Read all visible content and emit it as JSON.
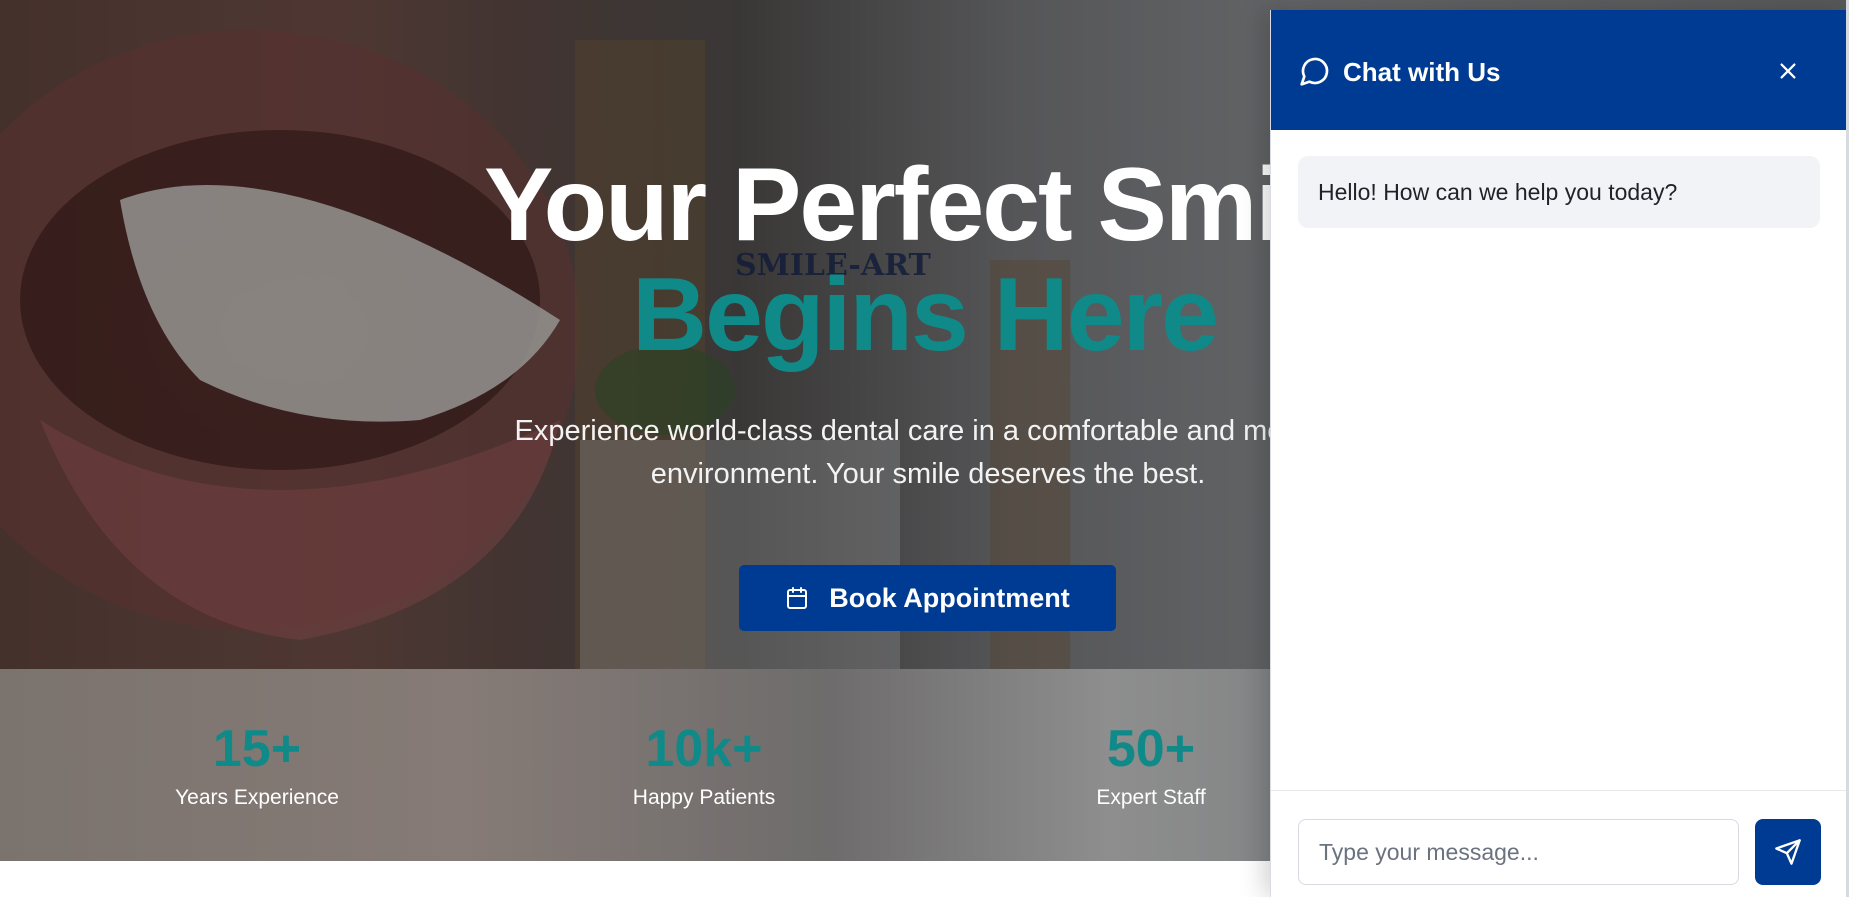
{
  "hero": {
    "title_line1": "Your Perfect Smile",
    "title_line2": "Begins Here",
    "subtitle": "Experience world-class dental care in a comfortable and modern environment. Your smile deserves the best.",
    "book_button_label": "Book Appointment",
    "book_button_icon": "calendar-icon",
    "background_sign_text": "SMILE-ART"
  },
  "stats": [
    {
      "value": "15+",
      "label": "Years Experience"
    },
    {
      "value": "10k+",
      "label": "Happy Patients"
    },
    {
      "value": "50+",
      "label": "Expert Staff"
    }
  ],
  "chat": {
    "title": "Chat with Us",
    "header_icon": "chat-bubble-icon",
    "close_icon": "close-icon",
    "messages": [
      {
        "from": "bot",
        "text": "Hello! How can we help you today?"
      }
    ],
    "input_placeholder": "Type your message...",
    "send_icon": "send-icon"
  },
  "colors": {
    "primary": "#003b93",
    "accent_teal": "#0f8a89",
    "message_bg": "#f1f3f6"
  }
}
